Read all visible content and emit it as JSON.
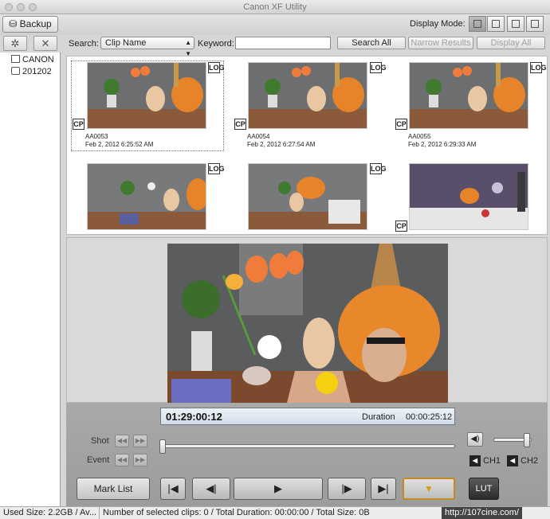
{
  "app": {
    "title": "Canon XF Utility"
  },
  "toolbar": {
    "backup_label": "Backup",
    "display_mode_label": "Display Mode:",
    "display_modes": [
      "large-thumbnail",
      "small-thumbnail",
      "detail",
      "list"
    ],
    "active_mode": "large-thumbnail"
  },
  "sidebar": {
    "tools": [
      {
        "icon": "gear-icon",
        "glyph": "✲"
      },
      {
        "icon": "delete-icon",
        "glyph": "✕"
      }
    ],
    "items": [
      {
        "label": "CANON",
        "icon": "card-icon"
      },
      {
        "label": "201202",
        "icon": "folder-stack-icon"
      }
    ]
  },
  "search": {
    "label": "Search:",
    "field_value": "Clip Name",
    "keyword_label": "Keyword:",
    "keyword_value": "",
    "search_all_label": "Search All",
    "narrow_label": "Narrow Results",
    "display_all_label": "Display All"
  },
  "clips": [
    {
      "name": "AA0053",
      "date": "Feb 2, 2012 6:25:52 AM",
      "log": "LOG",
      "cp": "CP",
      "selected": true
    },
    {
      "name": "AA0054",
      "date": "Feb 2, 2012 6:27:54 AM",
      "log": "LOG",
      "cp": "CP",
      "selected": false
    },
    {
      "name": "AA0055",
      "date": "Feb 2, 2012 6:29:33 AM",
      "log": "LOG",
      "cp": "CP",
      "selected": false
    },
    {
      "name": "",
      "date": "",
      "log": "LOG",
      "cp": "",
      "selected": false
    },
    {
      "name": "",
      "date": "",
      "log": "LOG",
      "cp": "",
      "selected": false
    },
    {
      "name": "",
      "date": "",
      "log": "",
      "cp": "CP",
      "selected": false
    }
  ],
  "player": {
    "timecode": "01:29:00:12",
    "duration_label": "Duration",
    "duration_value": "00:00:25:12",
    "shot_label": "Shot",
    "event_label": "Event",
    "ch1_label": "CH1",
    "ch2_label": "CH2",
    "mark_list_label": "Mark List",
    "lut_label": "LUT",
    "transport": [
      {
        "name": "go-to-start-button",
        "glyph": "|◀"
      },
      {
        "name": "step-back-button",
        "glyph": "◀|"
      },
      {
        "name": "play-button",
        "glyph": "▶"
      },
      {
        "name": "step-forward-button",
        "glyph": "|▶"
      },
      {
        "name": "go-to-end-button",
        "glyph": "▶|"
      }
    ],
    "marker_glyph": "▼",
    "playhead_fraction": 0.0,
    "volume_fraction": 0.95
  },
  "status": {
    "used_size": "Used Size: 2.2GB / Av...",
    "selection_info": "Number of selected clips: 0 / Total Duration: 00:00:00 / Total Size: 0B",
    "watermark": "http://107cine.com/"
  }
}
